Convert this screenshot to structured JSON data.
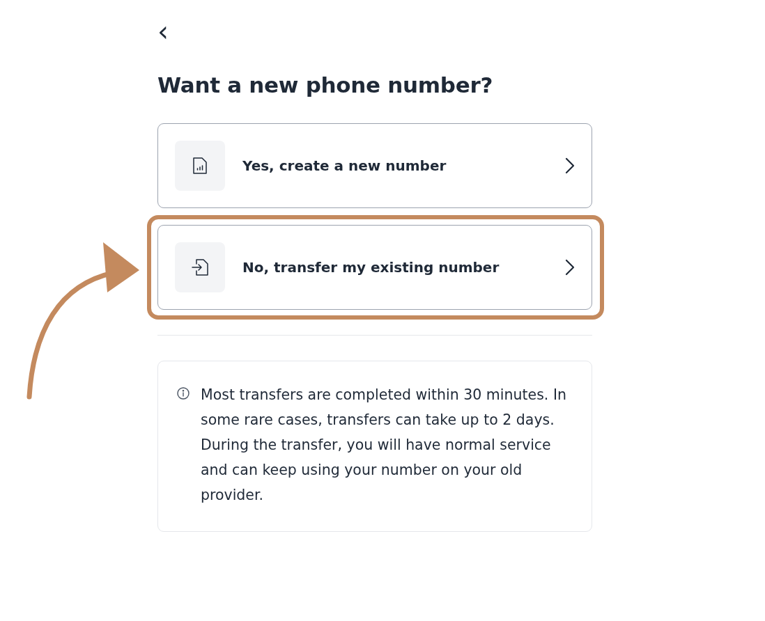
{
  "back_button": {
    "label": "‹"
  },
  "title": "Want a new phone number?",
  "options": [
    {
      "kind": "sim",
      "label": "Yes, create a new number",
      "highlighted": false
    },
    {
      "kind": "transfer",
      "label": "No, transfer my existing number",
      "highlighted": true
    }
  ],
  "info": {
    "text": "Most transfers are completed within 30 minutes. In some rare cases, transfers can take up to 2 days. During the transfer, you will have normal service and can keep using your number on your old provider."
  }
}
